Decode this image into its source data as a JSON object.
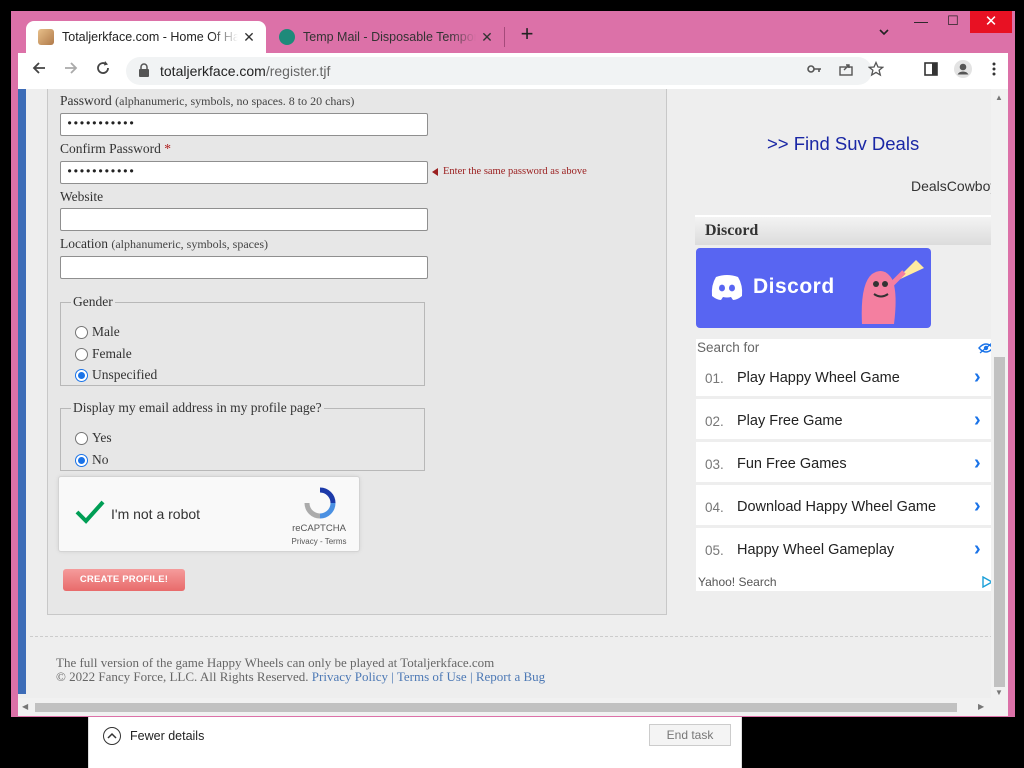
{
  "browser": {
    "tabs": [
      {
        "title": "Totaljerkface.com - Home Of Happy Wheels",
        "close": "✕"
      },
      {
        "title": "Temp Mail - Disposable Temporary Email",
        "close": "✕"
      }
    ],
    "new_tab": "+",
    "url_host": "totaljerkface.com",
    "url_path": "/register.tjf",
    "window_controls": {
      "minimize": "—",
      "maximize": "☐",
      "close": "✕"
    },
    "accent_color": "#dc71a8"
  },
  "form": {
    "password_label": "Password",
    "password_hint": "(alphanumeric, symbols, no spaces. 8 to 20 chars)",
    "password_value": "•••••••••••",
    "confirm_label": "Confirm Password",
    "required_mark": "*",
    "confirm_value": "•••••••••••",
    "confirm_error": "Enter the same password as above",
    "website_label": "Website",
    "website_value": "",
    "location_label": "Location",
    "location_hint": "(alphanumeric, symbols, spaces)",
    "location_value": "",
    "gender_legend": "Gender",
    "gender_options": [
      "Male",
      "Female",
      "Unspecified"
    ],
    "gender_selected": "Unspecified",
    "email_legend": "Display my email address in my profile page?",
    "email_options": [
      "Yes",
      "No"
    ],
    "email_selected": "No",
    "captcha_label": "I'm not a robot",
    "captcha_brand": "reCAPTCHA",
    "captcha_terms": "Privacy - Terms",
    "submit_label": "CREATE PROFILE!"
  },
  "sidebar": {
    "ad_link": ">> Find Suv Deals",
    "ad_source": "DealsCowboy",
    "discord_heading": "Discord",
    "discord_banner_text": "Discord",
    "search_for": "Search for",
    "search_results": [
      {
        "num": "01.",
        "text": "Play Happy Wheel Game"
      },
      {
        "num": "02.",
        "text": "Play Free Game"
      },
      {
        "num": "03.",
        "text": "Fun Free Games"
      },
      {
        "num": "04.",
        "text": "Download Happy Wheel Game"
      },
      {
        "num": "05.",
        "text": "Happy Wheel Gameplay"
      }
    ],
    "search_provider": "Yahoo! Search"
  },
  "footer": {
    "line1": "The full version of the game Happy Wheels can only be played at Totaljerkface.com",
    "copyright": "© 2022 Fancy Force, LLC. All Rights Reserved.",
    "links": [
      "Privacy Policy",
      "Terms of Use",
      "Report a Bug"
    ],
    "separator": "|"
  },
  "task_manager": {
    "fewer_details": "Fewer details",
    "end_task": "End task"
  }
}
